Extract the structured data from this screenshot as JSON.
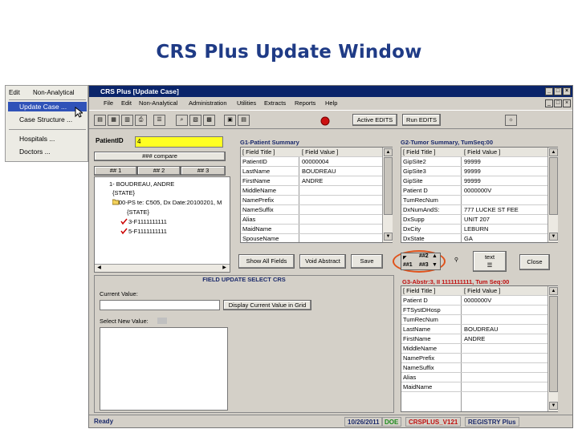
{
  "slide_title": "CRS Plus Update Window",
  "side_menu": {
    "menubar": [
      "Edit",
      "Non-Analytical"
    ],
    "items": [
      {
        "label": "Update Case ...",
        "selected": true
      },
      {
        "label": "Case Structure ..."
      },
      {
        "label": "Hospitals ..."
      },
      {
        "label": "Doctors ..."
      }
    ]
  },
  "window": {
    "title": "CRS Plus   [Update Case]",
    "menu": [
      "File",
      "Edit",
      "Non-Analytical",
      "Administration",
      "Utilities",
      "Extracts",
      "Reports",
      "Help"
    ],
    "toolbar": {
      "active_edits": "Active EDITS",
      "run_edits": "Run EDITS"
    },
    "patient_id_label": "PatientID",
    "patient_id_value": "4",
    "compare_btn": "### compare",
    "tabs": [
      "## 1",
      "## 2",
      "## 3"
    ],
    "tree": [
      "1- BOUDREAU, ANDRE",
      "{STATE}",
      "00-PS te: C505, Dx Date:20100201, M",
      "{STATE}",
      "3-F1111111111",
      "5-F1111111111"
    ],
    "g1": {
      "title": "G1-Patient Summary",
      "headers": [
        "[ Field Title ]",
        "[ Field Value ]"
      ],
      "rows": [
        [
          "PatientID",
          "00000004"
        ],
        [
          "LastName",
          "BOUDREAU"
        ],
        [
          "FirstName",
          "ANDRE"
        ],
        [
          "MiddleName",
          ""
        ],
        [
          "NamePrefix",
          ""
        ],
        [
          "NameSuffix",
          ""
        ],
        [
          "Alias",
          ""
        ],
        [
          "MaidName",
          ""
        ],
        [
          "SpouseName",
          ""
        ]
      ]
    },
    "g2": {
      "title": "G2-Tumor Summary, TumSeq:00",
      "headers": [
        "[ Field Title ]",
        "[ Field Value ]"
      ],
      "rows": [
        [
          "GipSite2",
          "99999"
        ],
        [
          "GipSite3",
          "99999"
        ],
        [
          "GipSite",
          "99999"
        ],
        [
          "Patient D",
          "0000000V"
        ],
        [
          "TumRecNum",
          ""
        ],
        [
          "DxNumAndS:",
          "777 LUCKE ST FEE"
        ],
        [
          "DxSupp",
          "UNIT 207"
        ],
        [
          "DxCity",
          "LEBURN"
        ],
        [
          "DxState",
          "GA"
        ]
      ]
    },
    "buttons": {
      "show_all": "Show All Fields",
      "void_abstract": "Void Abstract",
      "save": "Save",
      "nav_top": "##2",
      "nav_left": "##1",
      "nav_bottom": "##3",
      "text": "text",
      "close": "Close"
    },
    "field_update": {
      "title": "FIELD UPDATE SELECT CRS",
      "current_value_label": "Current Value:",
      "display_btn": "Display Current Value in Grid",
      "select_new_label": "Select New Value:"
    },
    "g3": {
      "title": "G3-Abstr:3, II 1111111111, Tum Seq:00",
      "headers": [
        "[ Field Title ]",
        "[ Field Value ]"
      ],
      "rows": [
        [
          "Patient D",
          "0000000V"
        ],
        [
          "FTSystDHosp",
          ""
        ],
        [
          "TumRecNum",
          ""
        ],
        [
          "LastName",
          "BOUDREAU"
        ],
        [
          "FirstName",
          "ANDRE"
        ],
        [
          "MiddleName",
          ""
        ],
        [
          "NamePrefix",
          ""
        ],
        [
          "NameSuffix",
          ""
        ],
        [
          "Alias",
          ""
        ],
        [
          "MaidName",
          ""
        ]
      ]
    },
    "status": {
      "ready": "Ready",
      "date": "10/26/2011",
      "doe": "DOE",
      "version": "CRSPLUS_V121",
      "registry": "REGISTRY Plus"
    }
  }
}
